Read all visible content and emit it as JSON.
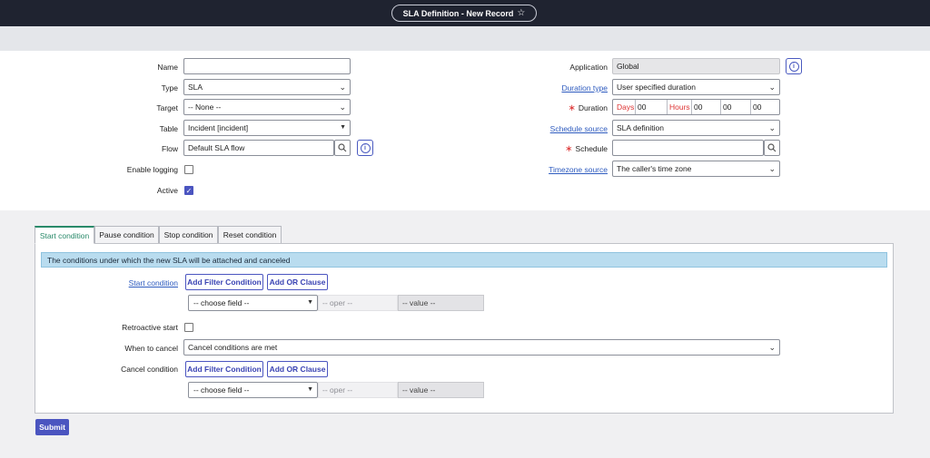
{
  "header": {
    "title": "SLA Definition - New Record",
    "favorite_icon": "star-icon"
  },
  "left_fields": {
    "name": {
      "label": "Name",
      "value": ""
    },
    "type": {
      "label": "Type",
      "value": "SLA"
    },
    "target": {
      "label": "Target",
      "value": "-- None --"
    },
    "table": {
      "label": "Table",
      "value": "Incident [incident]"
    },
    "flow": {
      "label": "Flow",
      "value": "Default SLA flow"
    },
    "enable_logging": {
      "label": "Enable logging",
      "checked": false
    },
    "active": {
      "label": "Active",
      "checked": true
    }
  },
  "right_fields": {
    "application": {
      "label": "Application",
      "value": "Global"
    },
    "duration_type": {
      "label": "Duration type",
      "value": "User specified duration"
    },
    "duration": {
      "label": "Duration",
      "days_label": "Days",
      "days": "00",
      "hours_label": "Hours",
      "hours": "00",
      "minutes": "00",
      "seconds": "00"
    },
    "schedule_source": {
      "label": "Schedule source",
      "value": "SLA definition"
    },
    "schedule": {
      "label": "Schedule",
      "value": ""
    },
    "timezone_source": {
      "label": "Timezone source",
      "value": "The caller's time zone"
    }
  },
  "tabs": [
    {
      "label": "Start condition",
      "active": true
    },
    {
      "label": "Pause condition",
      "active": false
    },
    {
      "label": "Stop condition",
      "active": false
    },
    {
      "label": "Reset condition",
      "active": false
    }
  ],
  "condition_panel": {
    "banner": "The conditions under which the new SLA will be attached and canceled",
    "start_condition_label": "Start condition",
    "add_filter_label": "Add Filter Condition",
    "add_or_label": "Add OR Clause",
    "choose_field": "-- choose field --",
    "oper": "-- oper --",
    "value": "-- value --",
    "retroactive_label": "Retroactive start",
    "retroactive_checked": false,
    "when_to_cancel_label": "When to cancel",
    "when_to_cancel_value": "Cancel conditions are met",
    "cancel_condition_label": "Cancel condition"
  },
  "submit_label": "Submit",
  "colors": {
    "accent": "#4b55c0",
    "header_bg": "#1f2330",
    "active_tab": "#2a8a6a",
    "banner_bg": "#b9dcef",
    "required": "#dd3333"
  }
}
